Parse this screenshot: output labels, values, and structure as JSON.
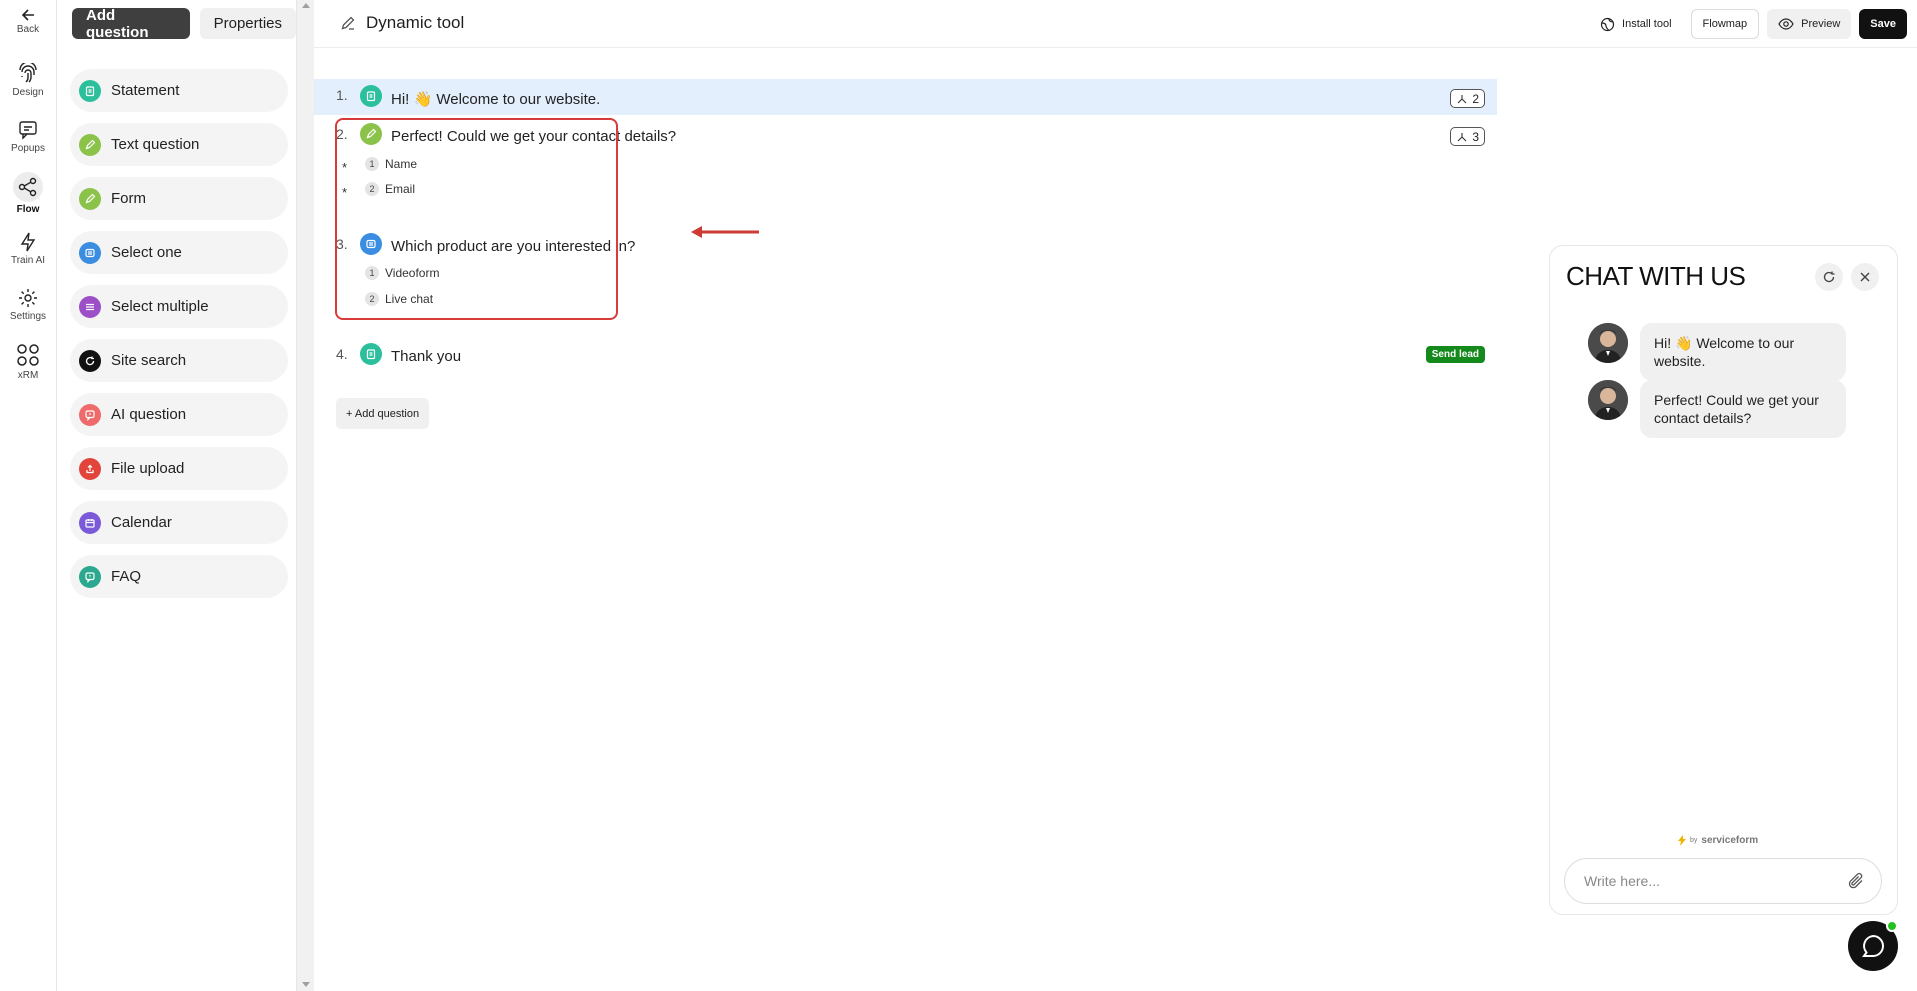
{
  "rail": {
    "back": "Back",
    "items": [
      {
        "label": "Design",
        "icon": "fingerprint-icon"
      },
      {
        "label": "Popups",
        "icon": "message-icon"
      },
      {
        "label": "Flow",
        "icon": "share-nodes-icon"
      },
      {
        "label": "Train AI",
        "icon": "lightning-icon"
      },
      {
        "label": "Settings",
        "icon": "gear-icon"
      },
      {
        "label": "xRM",
        "icon": "grid-icon"
      }
    ]
  },
  "panel": {
    "tabs": [
      "Add question",
      "Properties"
    ],
    "items": [
      {
        "label": "Statement",
        "color": "#2bbf9c"
      },
      {
        "label": "Text question",
        "color": "#8ac24a"
      },
      {
        "label": "Form",
        "color": "#8ac24a"
      },
      {
        "label": "Select one",
        "color": "#3a8de0"
      },
      {
        "label": "Select multiple",
        "color": "#9c4fc7"
      },
      {
        "label": "Site search",
        "color": "#111111"
      },
      {
        "label": "AI question",
        "color": "#ef6b6b"
      },
      {
        "label": "File upload",
        "color": "#e2443c"
      },
      {
        "label": "Calendar",
        "color": "#7a5ad8"
      },
      {
        "label": "FAQ",
        "color": "#2ba88f"
      }
    ]
  },
  "topbar": {
    "title": "Dynamic tool",
    "install": "Install tool",
    "flowmap": "Flowmap",
    "preview": "Preview",
    "save": "Save"
  },
  "flow": {
    "q1": {
      "num": "1.",
      "text": "Hi! 👋 Welcome to our website.",
      "badge": "2"
    },
    "q2": {
      "num": "2.",
      "text": "Perfect! Could we get your contact details?",
      "badge": "3",
      "fields": [
        {
          "n": "1",
          "label": "Name"
        },
        {
          "n": "2",
          "label": "Email"
        }
      ]
    },
    "q3": {
      "num": "3.",
      "text": "Which product are you interested in?",
      "options": [
        {
          "n": "1",
          "label": "Videoform"
        },
        {
          "n": "2",
          "label": "Live chat"
        }
      ]
    },
    "q4": {
      "num": "4.",
      "text": "Thank you",
      "tag": "Send lead"
    },
    "add_question": "+ Add question",
    "required_mark": "*"
  },
  "chat": {
    "title": "CHAT WITH US",
    "messages": [
      "Hi! 👋 Welcome to our website.",
      "Perfect! Could we get your contact details?"
    ],
    "brand_by": "by",
    "brand": "serviceform",
    "input_placeholder": "Write here..."
  }
}
